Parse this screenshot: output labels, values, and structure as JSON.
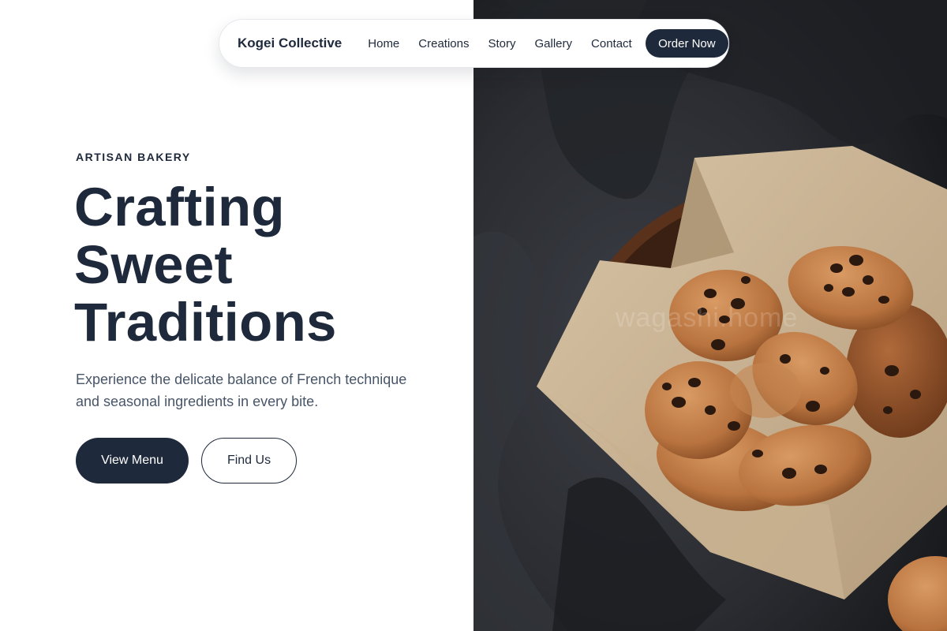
{
  "nav": {
    "brand": "Kogei Collective",
    "links": [
      "Home",
      "Creations",
      "Story",
      "Gallery",
      "Contact"
    ],
    "cta": "Order Now"
  },
  "hero": {
    "eyebrow": "ARTISAN BAKERY",
    "headline_lines": [
      "Crafting",
      "Sweet",
      "Traditions"
    ],
    "subtext": "Experience the delicate balance of French technique and seasonal ingredients in every bite.",
    "primary_button": "View Menu",
    "secondary_button": "Find Us"
  },
  "image": {
    "subject": "bowl of chocolate chip cookies on parchment paper over dark cloth",
    "watermark": "wagashi.home"
  },
  "colors": {
    "primary": "#1e293b",
    "text_muted": "#475569",
    "background": "#ffffff",
    "image_background": "#2a2c31"
  }
}
